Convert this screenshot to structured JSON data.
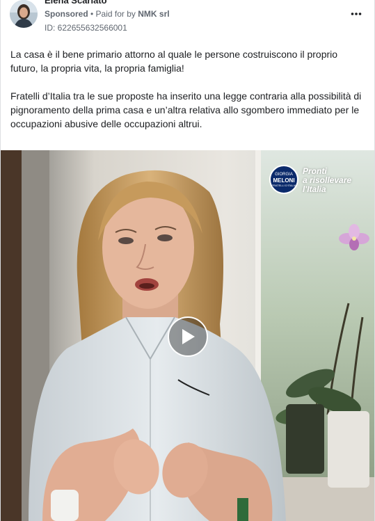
{
  "post": {
    "author": "Elena Scariato",
    "sponsored_label": "Sponsored",
    "separator": " • ",
    "paid_for_prefix": "Paid for by ",
    "payer": "NMK srl",
    "ad_id": "ID: 622655632566001",
    "more_icon": "more-horizontal-icon"
  },
  "body": {
    "paragraph1": "La casa è il bene primario attorno al quale le persone costruiscono il proprio futuro, la propria vita, la propria famiglia!",
    "paragraph2": "Fratelli d’Italia tra le sue proposte ha inserito una legge contraria alla possibilità di pignoramento della prima casa e un’altra relativa allo sgombero immediato per le occupazioni abusive delle occupazioni altrui.",
    "ellipsis": "..."
  },
  "video": {
    "play_icon": "play-icon",
    "logo": {
      "line1": "GIORGIA",
      "line2": "MELONI",
      "line3": "FRATELLI D'ITALIA"
    },
    "slogan": {
      "line1": "Pronti",
      "line2": "a risollevare",
      "line3": "l'Italia"
    }
  },
  "colors": {
    "text": "#1c1e21",
    "meta": "#606770",
    "logo_blue": "#0b2a6b"
  }
}
